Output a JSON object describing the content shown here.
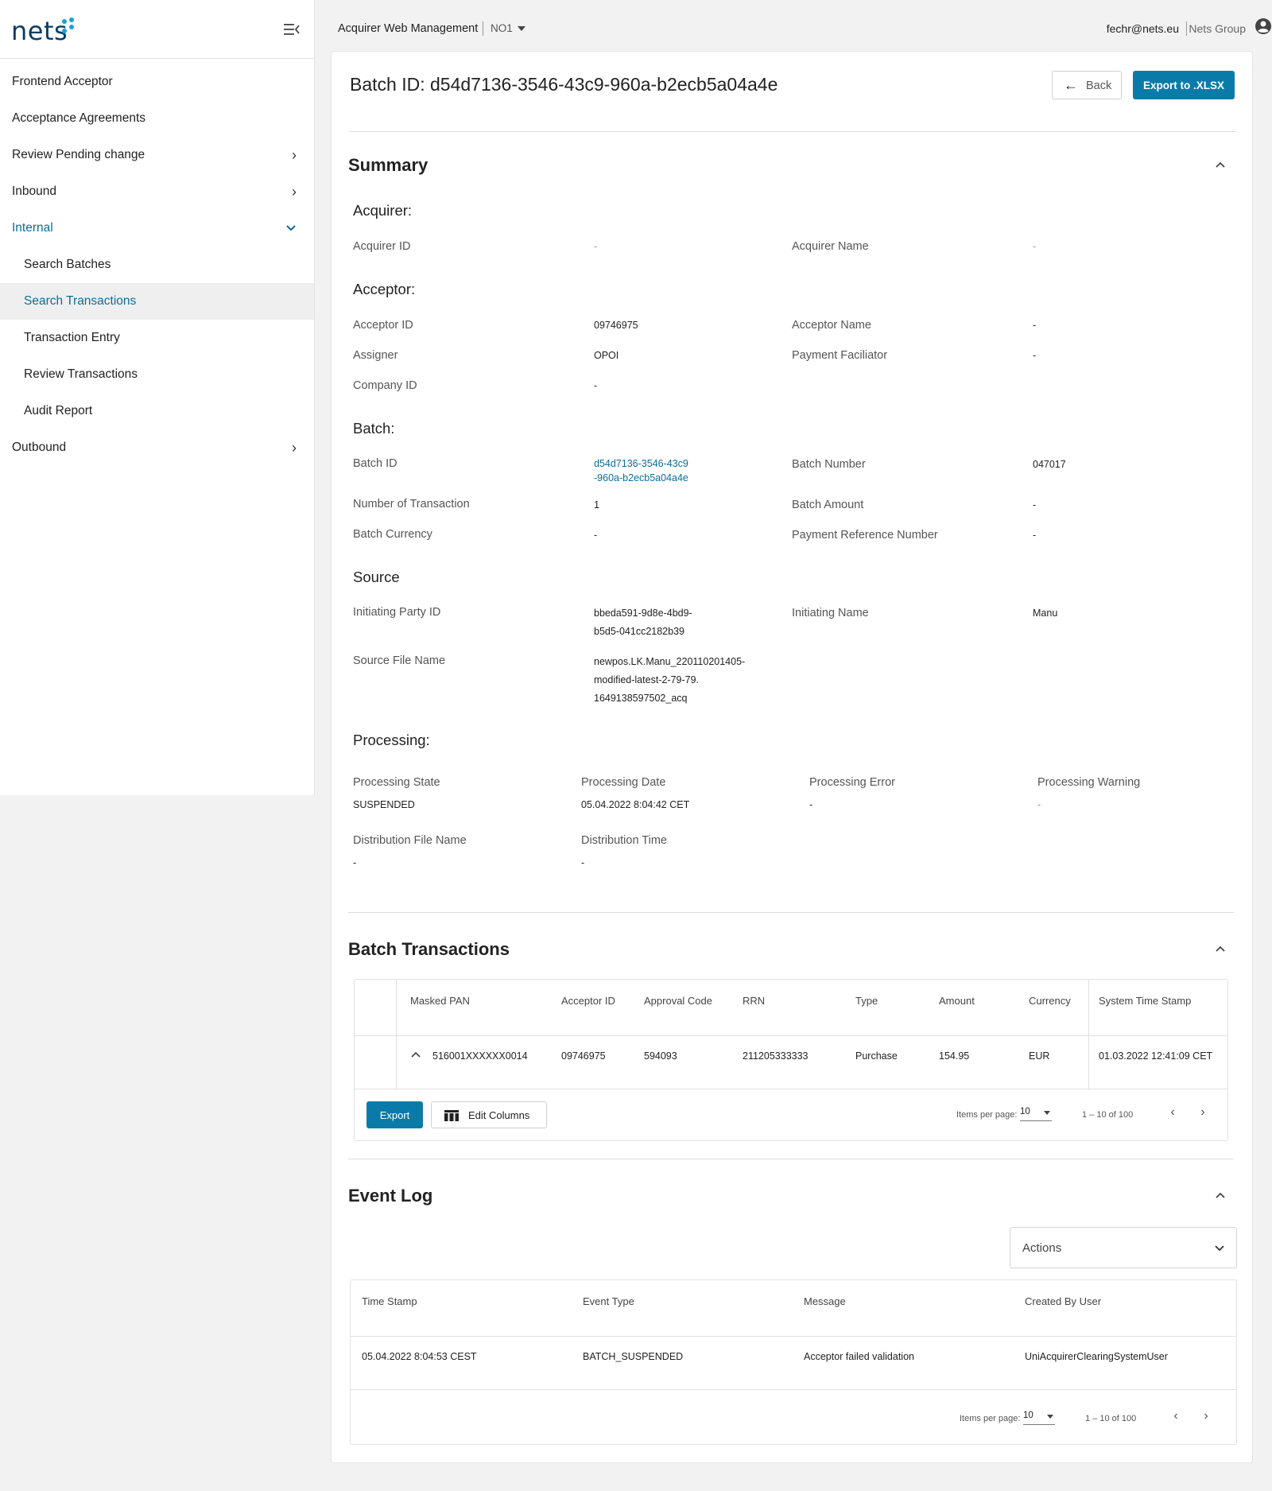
{
  "brand": {
    "logo_text": "nets",
    "accent": "#0a7ba8",
    "link_color": "#0a6e9b"
  },
  "sidebar": {
    "items": [
      {
        "label": "Frontend Acceptor",
        "chevron": ""
      },
      {
        "label": "Acceptance Agreements",
        "chevron": ""
      },
      {
        "label": "Review Pending change",
        "chevron": "›"
      },
      {
        "label": "Inbound",
        "chevron": "›"
      },
      {
        "label": "Internal",
        "chevron": "⌄"
      },
      {
        "label": "Search Batches"
      },
      {
        "label": "Search Transactions"
      },
      {
        "label": "Transaction Entry"
      },
      {
        "label": "Review Transactions"
      },
      {
        "label": "Audit Report"
      },
      {
        "label": "Outbound",
        "chevron": "›"
      }
    ]
  },
  "topbar": {
    "app_title": "Acquirer Web Management",
    "org": "NO1",
    "user_email": "fechr@nets.eu",
    "group": "Nets Group"
  },
  "page": {
    "title": "Batch ID: d54d7136-3546-43c9-960a-b2ecb5a04a4e",
    "back_label": "Back",
    "export_label": "Export to .XLSX"
  },
  "summary": {
    "title": "Summary",
    "acquirer": {
      "heading": "Acquirer:",
      "id_label": "Acquirer ID",
      "id_value": "-",
      "name_label": "Acquirer Name",
      "name_value": "-"
    },
    "acceptor": {
      "heading": "Acceptor:",
      "id_label": "Acceptor ID",
      "id_value": "09746975",
      "name_label": "Acceptor Name",
      "name_value": "-",
      "assigner_label": "Assigner",
      "assigner_value": "OPOI",
      "facilitator_label": "Payment Faciliator",
      "facilitator_value": "-",
      "company_label": "Company ID",
      "company_value": "-"
    },
    "batch": {
      "heading": "Batch:",
      "id_label": "Batch ID",
      "id_value_1": "d54d7136-3546-43c9",
      "id_value_2": "-960a-b2ecb5a04a4e",
      "number_label": "Batch Number",
      "number_value": "047017",
      "count_label": "Number of Transaction",
      "count_value": "1",
      "amount_label": "Batch Amount",
      "amount_value": "-",
      "currency_label": "Batch Currency",
      "currency_value": "-",
      "ref_label": "Payment Reference Number",
      "ref_value": "-"
    },
    "source": {
      "heading": "Source",
      "party_label": "Initiating Party ID",
      "party_value_1": "bbeda591-9d8e-4bd9-",
      "party_value_2": "b5d5-041cc2182b39",
      "name_label": "Initiating Name",
      "name_value": "Manu",
      "file_label": "Source File Name",
      "file_value_1": "newpos.LK.Manu_220110201405-",
      "file_value_2": "modified-latest-2-79-79.",
      "file_value_3": "1649138597502_acq"
    },
    "processing": {
      "heading": "Processing:",
      "state_label": "Processing State",
      "state_value": "SUSPENDED",
      "date_label": "Processing Date",
      "date_value": "05.04.2022 8:04:42 CET",
      "error_label": "Processing Error",
      "error_value": "-",
      "warning_label": "Processing Warning",
      "warning_value": "-",
      "dist_file_label": "Distribution File Name",
      "dist_file_value": "-",
      "dist_time_label": "Distribution Time",
      "dist_time_value": "-"
    }
  },
  "batch_transactions": {
    "title": "Batch Transactions",
    "columns": [
      "Masked PAN",
      "Acceptor ID",
      "Approval Code",
      "RRN",
      "Type",
      "Amount",
      "Currency",
      "System Time Stamp"
    ],
    "rows": [
      [
        "516001XXXXXX0014",
        "09746975",
        "594093",
        "211205333333",
        "Purchase",
        "154.95",
        "EUR",
        "01.03.2022 12:41:09 CET"
      ]
    ],
    "export_label": "Export",
    "edit_columns_label": "Edit Columns",
    "items_per_page_label": "Items per page:",
    "items_per_page": "10",
    "range": "1 – 10 of 100"
  },
  "event_log": {
    "title": "Event Log",
    "actions_label": "Actions",
    "columns": [
      "Time Stamp",
      "Event Type",
      "Message",
      "Created By User"
    ],
    "rows": [
      [
        "05.04.2022 8:04:53 CEST",
        "BATCH_SUSPENDED",
        "Acceptor failed validation",
        "UniAcquirerClearingSystemUser"
      ]
    ],
    "items_per_page_label": "Items per page:",
    "items_per_page": "10",
    "range": "1 – 10 of 100"
  }
}
